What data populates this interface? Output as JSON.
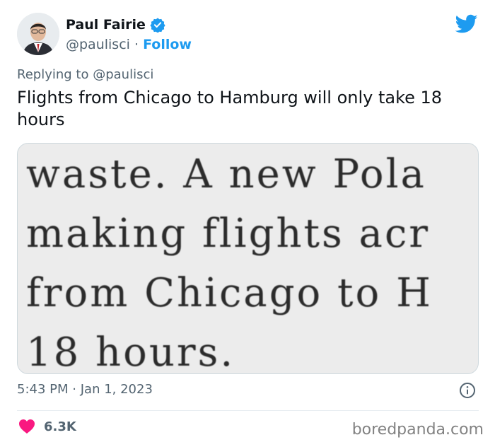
{
  "author": {
    "name": "Paul Fairie",
    "handle": "@paulisci",
    "separator": "·",
    "follow_label": "Follow",
    "verified_icon": "verified-badge-icon",
    "avatar_icon": "avatar"
  },
  "reply": {
    "prefix": "Replying to",
    "mention": "@paulisci"
  },
  "tweet": {
    "text": "Flights from Chicago to Hamburg will only take 18 hours"
  },
  "media": {
    "lines": [
      "waste.  A new Pola",
      "making  flights  acr",
      "from  Chicago  to  H",
      "18 hours."
    ]
  },
  "meta": {
    "time": "5:43 PM",
    "separator": "·",
    "date": "Jan 1, 2023"
  },
  "engagement": {
    "likes": "6.3K"
  },
  "watermark": "boredpanda.com",
  "colors": {
    "accent": "#1d9bf0",
    "heart": "#f91880",
    "muted": "#536471",
    "text": "#0f1419"
  }
}
